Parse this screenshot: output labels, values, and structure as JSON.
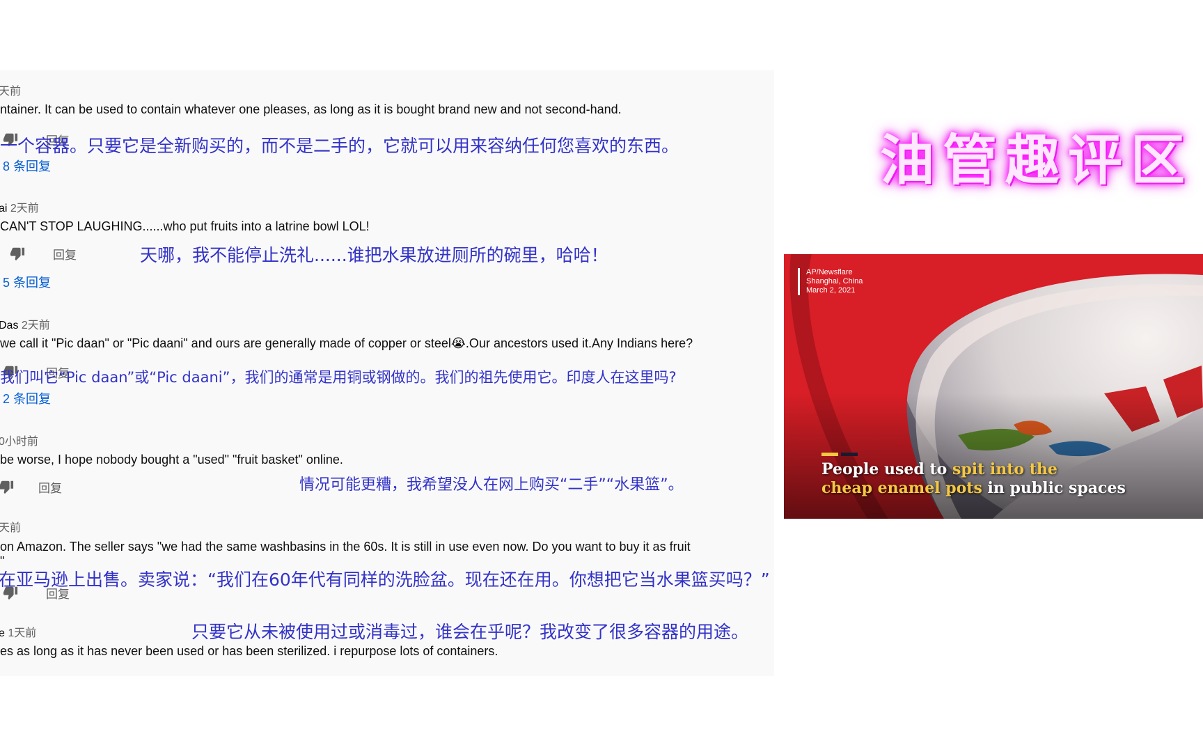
{
  "comments": [
    {
      "meta_author": "",
      "meta_time": "天前",
      "text": "ntainer. It can be used to contain whatever one pleases, as long as it is bought brand new and not second-hand.",
      "translation": "一个容器。只要它是全新购买的，而不是二手的，它就可以用来容纳任何您喜欢的东西。",
      "reply_label": "回复",
      "replies_link": "8 条回复"
    },
    {
      "meta_author": "ai",
      "meta_time": "2天前",
      "text": "CAN'T STOP LAUGHING......who put fruits into a latrine bowl LOL!",
      "translation": "天哪，我不能停止洗礼......谁把水果放进厕所的碗里，哈哈！",
      "reply_label": "回复",
      "replies_link": "5 条回复"
    },
    {
      "meta_author": "Das",
      "meta_time": "2天前",
      "text": "we call it \"Pic daan\" or \"Pic daani\" and ours are generally made of copper or steel😭.Our ancestors used it.Any Indians here?",
      "translation": "我们叫它“Pic daan”或“Pic daani”，我们的通常是用铜或钢做的。我们的祖先使用它。印度人在这里吗?",
      "reply_label": "回复",
      "replies_link": "2 条回复"
    },
    {
      "meta_author": "",
      "meta_time": "0小时前",
      "text": "be worse, I hope nobody bought a \"used\" \"fruit basket\" online.",
      "translation": "情况可能更糟，我希望没人在网上购买“二手”“水果篮”。",
      "reply_label": "回复"
    },
    {
      "meta_author": "",
      "meta_time": "天前",
      "text": "on Amazon. The seller says \"we had the same washbasins in the 60s. It is still in use even now. Do you want to buy it as fruit",
      "text_cont": "\"",
      "translation": "在亚马逊上出售。卖家说：“我们在60年代有同样的洗脸盆。现在还在用。你想把它当水果篮买吗？”",
      "reply_label": "回复"
    },
    {
      "meta_author": "e",
      "meta_time": "1天前",
      "text": "es as long as it has never been used or has been sterilized. i repurpose lots of containers.",
      "translation": "只要它从未被使用过或消毒过，谁会在乎呢？我改变了很多容器的用途。"
    }
  ],
  "watermark": "油管趣评区",
  "video": {
    "credit_source": "AP/Newsflare",
    "credit_location": "Shanghai, China",
    "credit_date": "March 2, 2021",
    "caption_part1": "People used to ",
    "caption_highlight1": "spit into the",
    "caption_highlight2": "cheap enamel pots",
    "caption_part2": " in public spaces",
    "bar_colors": [
      "#f5c842",
      "#1a1a2e"
    ]
  },
  "colors": {
    "translation": "#3232c8",
    "link": "#065fd4",
    "watermark_glow": "#ff00ff",
    "caption_highlight": "#f5c842"
  },
  "icons": {
    "dislike": "thumb-down-icon"
  }
}
